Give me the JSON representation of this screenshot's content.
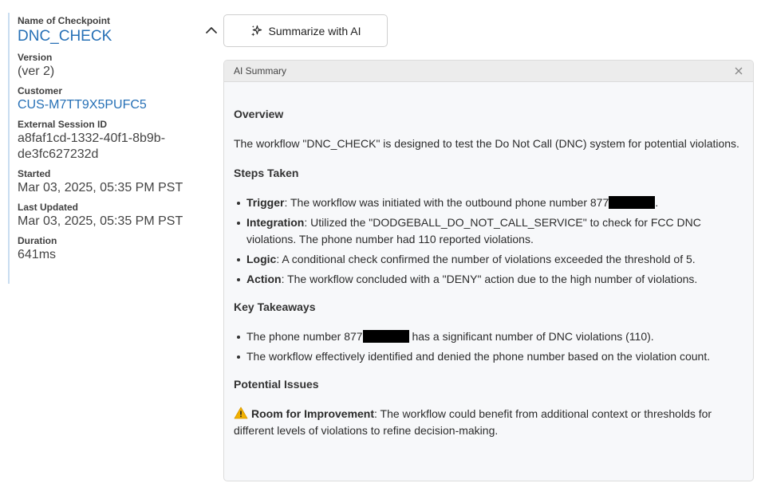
{
  "details": {
    "checkpoint_label": "Name of Checkpoint",
    "checkpoint_value": "DNC_CHECK",
    "version_label": "Version",
    "version_value": "(ver 2)",
    "customer_label": "Customer",
    "customer_value": "CUS-M7TT9X5PUFC5",
    "session_label": "External Session ID",
    "session_value_line1": "a8faf1cd-1332-40f1-8b9b-",
    "session_value_line2": "de3fc627232d",
    "started_label": "Started",
    "started_value": "Mar 03, 2025, 05:35 PM PST",
    "updated_label": "Last Updated",
    "updated_value": "Mar 03, 2025, 05:35 PM PST",
    "duration_label": "Duration",
    "duration_value": "641ms"
  },
  "toolbar": {
    "summarize_label": "Summarize with AI"
  },
  "summary": {
    "header_title": "AI Summary",
    "overview_heading": "Overview",
    "overview_text": "The workflow \"DNC_CHECK\" is designed to test the Do Not Call (DNC) system for potential violations.",
    "steps_heading": "Steps Taken",
    "steps": [
      {
        "term": "Trigger",
        "text_before": ": The workflow was initiated with the outbound phone number 877",
        "text_after": "."
      },
      {
        "term": "Integration",
        "text": ": Utilized the \"DODGEBALL_DO_NOT_CALL_SERVICE\" to check for FCC DNC violations. The phone number had 110 reported violations."
      },
      {
        "term": "Logic",
        "text": ": A conditional check confirmed the number of violations exceeded the threshold of 5."
      },
      {
        "term": "Action",
        "text": ": The workflow concluded with a \"DENY\" action due to the high number of violations."
      }
    ],
    "takeaways_heading": "Key Takeaways",
    "takeaways": [
      {
        "text_before": "The phone number 877",
        "text_after": " has a significant number of DNC violations (110)."
      },
      {
        "text": "The workflow effectively identified and denied the phone number based on the violation count."
      }
    ],
    "issues_heading": "Potential Issues",
    "issue_term": "Room for Improvement",
    "issue_text": ": The workflow could benefit from additional context or thresholds for different levels of violations to refine decision-making."
  },
  "colors": {
    "link": "#2670b6",
    "panel_bg": "#f7f8fa",
    "header_bg": "#ececec",
    "warning": "#f2b100"
  },
  "icons": [
    "chevron-up-icon",
    "sparkles-icon",
    "close-icon",
    "warning-icon"
  ]
}
